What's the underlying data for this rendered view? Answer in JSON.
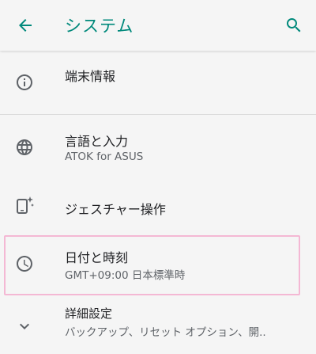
{
  "app_bar": {
    "title": "システム",
    "back_icon": "arrow-left-icon",
    "search_icon": "search-icon"
  },
  "colors": {
    "accent": "#00897b",
    "icon": "#5f6368",
    "highlight": "#f4b8d4",
    "background": "#f5f5f5"
  },
  "items": [
    {
      "icon": "info-icon",
      "title": "端末情報"
    },
    {
      "icon": "globe-icon",
      "title": "言語と入力",
      "subtitle": "ATOK for ASUS"
    },
    {
      "icon": "gesture-phone-icon",
      "title": "ジェスチャー操作"
    },
    {
      "icon": "clock-icon",
      "title": "日付と時刻",
      "subtitle": "GMT+09:00 日本標準時"
    },
    {
      "icon": "chevron-down-icon",
      "title": "詳細設定",
      "subtitle": "バックアップ、リセット オプション、開.."
    }
  ]
}
